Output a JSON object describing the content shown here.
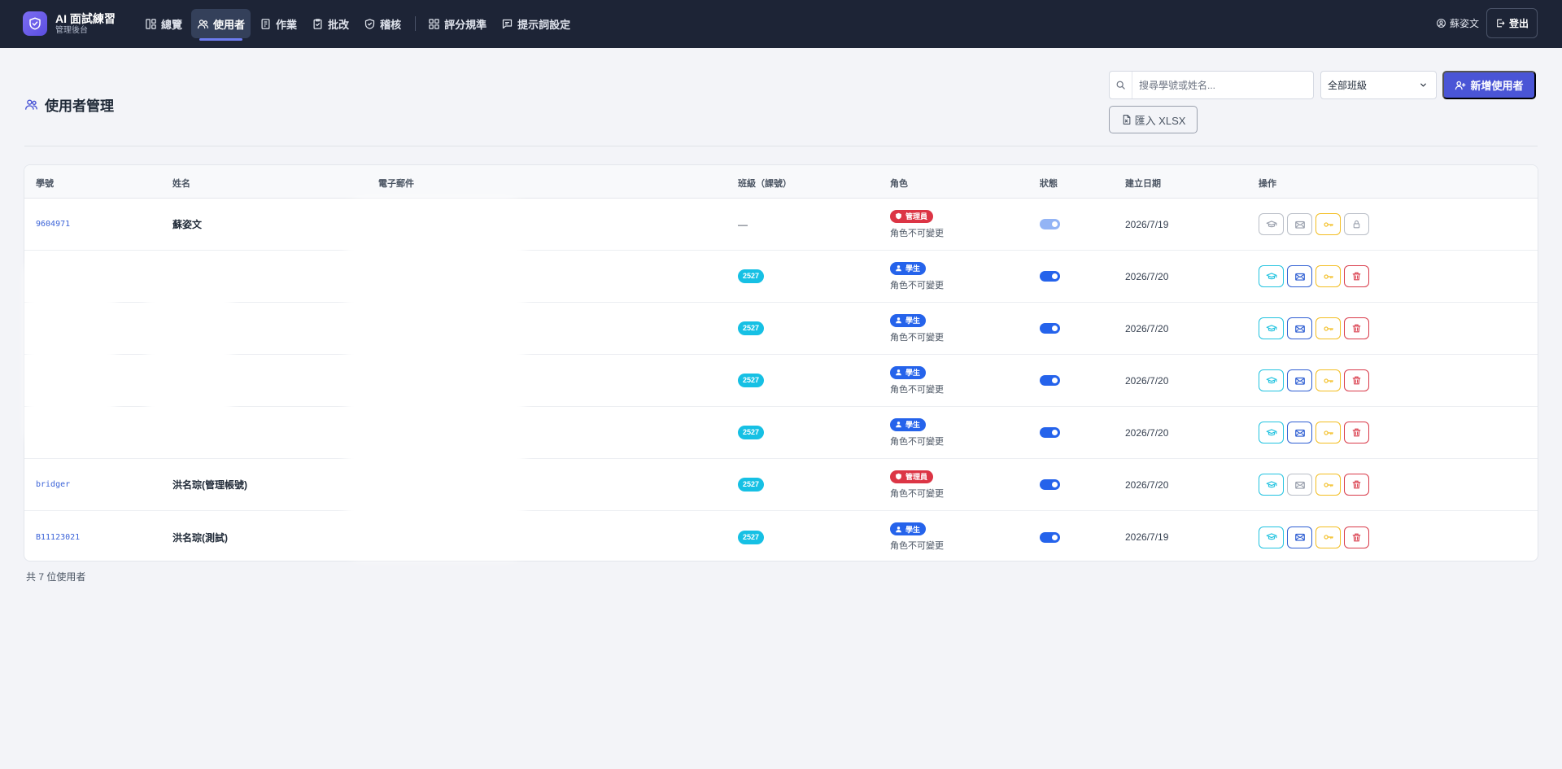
{
  "app": {
    "title": "AI 面試練習",
    "subtitle": "管理後台"
  },
  "nav": [
    {
      "label": "總覽",
      "icon": "dashboard-icon"
    },
    {
      "label": "使用者",
      "icon": "users-icon",
      "active": true
    },
    {
      "label": "作業",
      "icon": "assignment-icon"
    },
    {
      "label": "批改",
      "icon": "clipboard-check-icon"
    },
    {
      "label": "稽核",
      "icon": "shield-check-icon"
    },
    {
      "label": "評分規準",
      "icon": "grid-icon"
    },
    {
      "label": "提示詞設定",
      "icon": "message-icon"
    }
  ],
  "user": {
    "name": "蘇姿文",
    "logout_label": "登出"
  },
  "page": {
    "title": "使用者管理",
    "search_placeholder": "搜尋學號或姓名...",
    "class_filter": "全部班級",
    "add_user_label": "新增使用者",
    "import_label": "匯入 XLSX"
  },
  "table": {
    "columns": [
      "學號",
      "姓名",
      "電子郵件",
      "班級（課號）",
      "角色",
      "狀態",
      "建立日期",
      "操作"
    ],
    "rows": [
      {
        "id": "9604971",
        "name": "蘇姿文",
        "email": "",
        "class": "—",
        "role": "管理員",
        "role_type": "admin",
        "role_note": "角色不可變更",
        "active": false,
        "date": "2026/7/19",
        "locked": true
      },
      {
        "id": "",
        "name": "",
        "email": "",
        "class": "2527",
        "role": "學生",
        "role_type": "student",
        "role_note": "角色不可變更",
        "active": true,
        "date": "2026/7/20",
        "locked": false
      },
      {
        "id": "",
        "name": "",
        "email": "",
        "class": "2527",
        "role": "學生",
        "role_type": "student",
        "role_note": "角色不可變更",
        "active": true,
        "date": "2026/7/20",
        "locked": false
      },
      {
        "id": "",
        "name": "",
        "email": "",
        "class": "2527",
        "role": "學生",
        "role_type": "student",
        "role_note": "角色不可變更",
        "active": true,
        "date": "2026/7/20",
        "locked": false
      },
      {
        "id": "",
        "name": "",
        "email": "",
        "class": "2527",
        "role": "學生",
        "role_type": "student",
        "role_note": "角色不可變更",
        "active": true,
        "date": "2026/7/20",
        "locked": false
      },
      {
        "id": "bridger",
        "name": "洪名琮(管理帳號)",
        "email": "",
        "class": "2527",
        "role": "管理員",
        "role_type": "admin",
        "role_note": "角色不可變更",
        "active": true,
        "date": "2026/7/20",
        "locked": false
      },
      {
        "id": "B11123021",
        "name": "洪名琮(測試)",
        "email": "",
        "class": "2527",
        "role": "學生",
        "role_type": "student",
        "role_note": "角色不可變更",
        "active": true,
        "date": "2026/7/19",
        "locked": false
      }
    ]
  },
  "footer": {
    "count_text": "共 7 位使用者"
  },
  "colors": {
    "topbar": "#1d2436",
    "accent": "#4a55d6",
    "admin": "#dc3545",
    "student": "#2563eb",
    "class_badge": "#16c0e4"
  }
}
